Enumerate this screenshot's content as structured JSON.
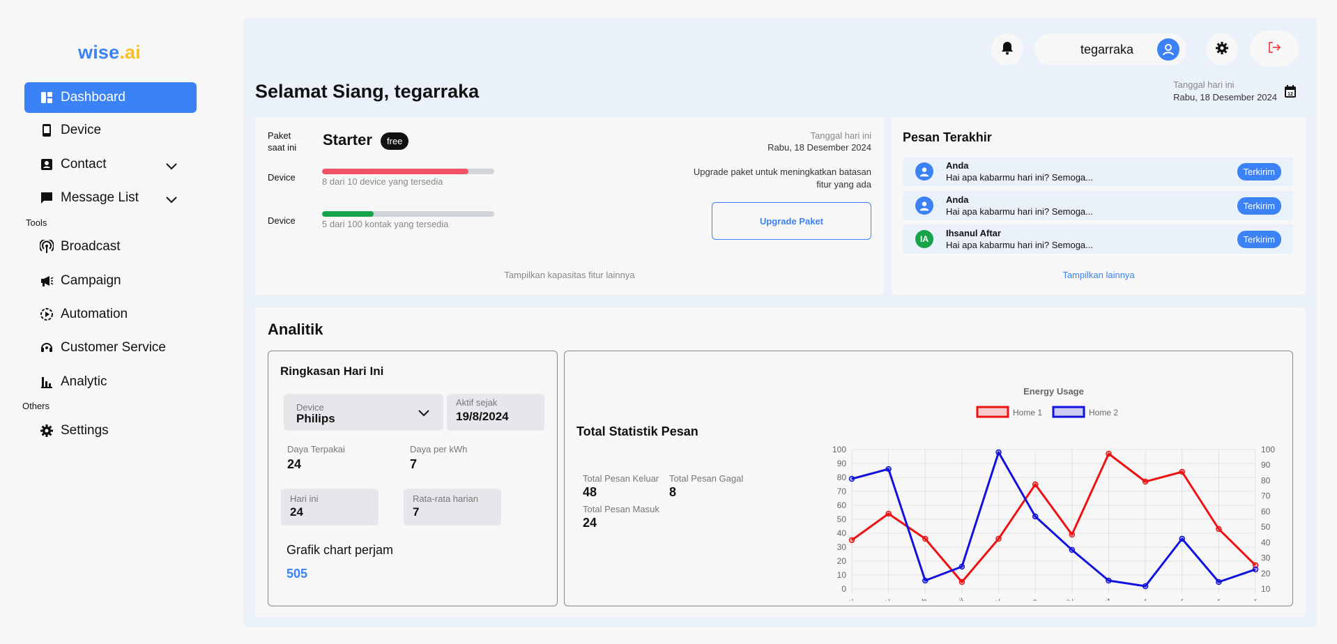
{
  "brand": {
    "prefix": "wise",
    "dot": ".",
    "suffix": "ai"
  },
  "sidebar": {
    "items": [
      {
        "label": "Dashboard"
      },
      {
        "label": "Device"
      },
      {
        "label": "Contact"
      },
      {
        "label": "Message List"
      }
    ],
    "tools_label": "Tools",
    "tools": [
      {
        "label": "Broadcast"
      },
      {
        "label": "Campaign"
      },
      {
        "label": "Automation"
      },
      {
        "label": "Customer Service"
      },
      {
        "label": "Analytic"
      }
    ],
    "others_label": "Others",
    "others": [
      {
        "label": "Settings"
      }
    ]
  },
  "topbar": {
    "username": "tegarraka"
  },
  "greeting": "Selamat Siang, tegarraka",
  "date_label": "Tanggal hari ini",
  "date_value": "Rabu, 18 Desember 2024",
  "plan": {
    "label_line1": "Paket",
    "label_line2": "saat ini",
    "name": "Starter",
    "badge": "free",
    "rows": [
      {
        "label": "Device",
        "caption": "8 dari 10 device yang tersedia",
        "fraction": 0.85,
        "color": "#f05264"
      },
      {
        "label": "Device",
        "caption": "5 dari 100 kontak yang tersedia",
        "fraction": 0.3,
        "color": "#16a34a"
      }
    ],
    "date_label": "Tanggal hari ini",
    "date_value": "Rabu, 18 Desember 2024",
    "upgrade_text": "Upgrade paket untuk meningkatkan batasan fitur yang ada",
    "upgrade_button": "Upgrade Paket",
    "more": "Tampilkan kapasitas fitur lainnya"
  },
  "messages": {
    "title": "Pesan Terakhir",
    "items": [
      {
        "name": "Anda",
        "text": "Hai apa kabarmu hari ini? Semoga...",
        "status": "Terkirim",
        "avatar": "user-icon",
        "avatar_color": "#3b82f6"
      },
      {
        "name": "Anda",
        "text": "Hai apa kabarmu hari ini? Semoga...",
        "status": "Terkirim",
        "avatar": "user-icon",
        "avatar_color": "#3b82f6"
      },
      {
        "name": "Ihsanul Aftar",
        "text": "Hai apa kabarmu hari ini? Semoga...",
        "status": "Terkirim",
        "initials": "IA",
        "avatar_color": "#16a34a"
      }
    ],
    "more": "Tampilkan lainnya"
  },
  "analitik": {
    "title": "Analitik",
    "ringkasan": {
      "title": "Ringkasan Hari Ini",
      "device_label": "Device",
      "device_value": "Philips",
      "aktif_label": "Aktif sejak",
      "aktif_value": "19/8/2024",
      "daya_label": "Daya Terpakai",
      "daya_value": "24",
      "kwh_label": "Daya per kWh",
      "kwh_value": "7",
      "hari_label": "Hari ini",
      "hari_value": "24",
      "rata_label": "Rata-rata harian",
      "rata_value": "7",
      "grafik_title": "Grafik chart perjam",
      "grafik_value": "505"
    },
    "statistik": {
      "title": "Total Statistik Pesan",
      "keluar_label": "Total Pesan Keluar",
      "keluar_value": "48",
      "gagal_label": "Total Pesan Gagal",
      "gagal_value": "8",
      "masuk_label": "Total Pesan Masuk",
      "masuk_value": "24"
    }
  },
  "chart_data": {
    "type": "line",
    "title": "Energy Usage",
    "categories": [
      "January",
      "February",
      "March",
      "April",
      "May",
      "June",
      "July",
      "August",
      "September",
      "October",
      "November",
      "December"
    ],
    "series": [
      {
        "name": "Home 1",
        "values": [
          35,
          54,
          36,
          5,
          36,
          75,
          39,
          97,
          77,
          84,
          43,
          17
        ],
        "color": "#ee1111",
        "axis": "left"
      },
      {
        "name": "Home 2",
        "values": [
          79,
          86,
          6,
          16,
          98,
          52,
          28,
          6,
          2,
          36,
          5,
          14
        ],
        "color": "#1111dd",
        "axis": "left"
      }
    ],
    "ylim_left": [
      0,
      100
    ],
    "ylim_right": [
      10,
      100
    ],
    "yticks_left": [
      0,
      10,
      20,
      30,
      40,
      50,
      60,
      70,
      80,
      90,
      100
    ],
    "yticks_right": [
      10,
      20,
      30,
      40,
      50,
      60,
      70,
      80,
      90,
      100
    ],
    "grid": true,
    "legend": "top-center"
  }
}
